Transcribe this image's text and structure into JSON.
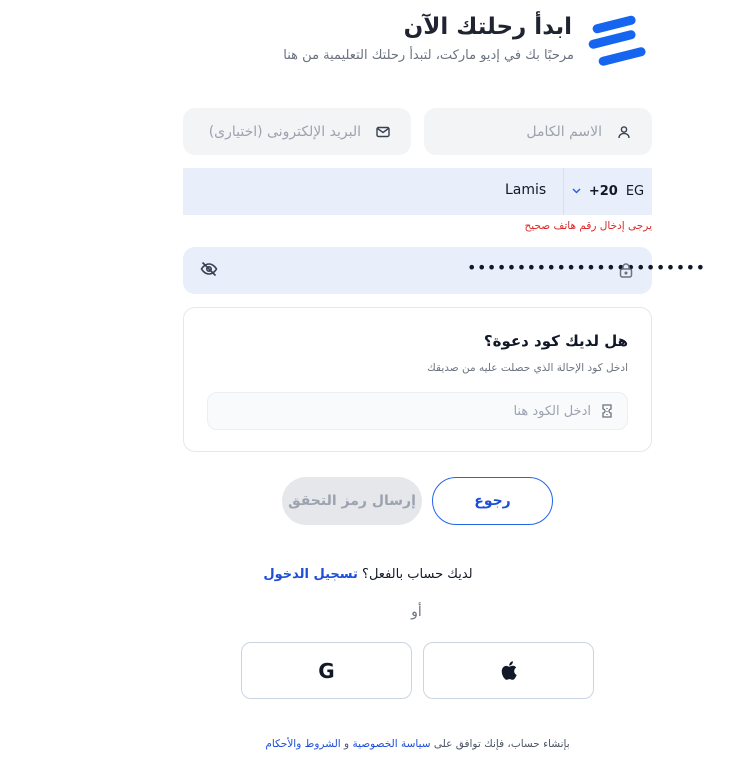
{
  "header": {
    "title": "ابدأ رحلتك الآن",
    "subtitle": "مرحبًا بك في إديو ماركت، لتبدأ رحلتك التعليمية من هنا",
    "logo_icon": "edumarket-logo-icon"
  },
  "form": {
    "full_name": {
      "placeholder": "الاسم الكامل",
      "icon": "user-icon"
    },
    "email": {
      "placeholder": "البريد الإلكترونى (اختيارى)",
      "icon": "mail-icon"
    },
    "phone": {
      "value": "Lamis",
      "country": "EG",
      "dial_code": "+20",
      "icon": "chevron-down-icon"
    },
    "phone_error": "يرجى إدخال رقم هاتف صحيح",
    "password": {
      "value": "••••••••••••••••••••••••",
      "icon": "lock-icon",
      "toggle_icon": "eye-off-icon"
    }
  },
  "invite": {
    "title": "هل لديك كود دعوة؟",
    "description": "ادخل كود الإحالة الذي حصلت عليه من صديقك",
    "placeholder": "ادخل الكود هنا",
    "icon": "ticket-icon"
  },
  "actions": {
    "back_label": "رجوع",
    "send_code_label": "إرسال رمز التحقق"
  },
  "login": {
    "prompt": "لديك حساب بالفعل؟",
    "link": "تسجيل الدخول"
  },
  "divider_text": "أو",
  "social": {
    "google_label": "G",
    "google_icon": "google-icon",
    "apple_icon": "apple-icon"
  },
  "terms": {
    "prefix": "بإنشاء حساب، فإنك توافق على",
    "privacy_link": "سياسة الخصوصية",
    "conjunction": "و",
    "terms_link": "الشروط والأحكام"
  },
  "colors": {
    "accent": "#2563eb",
    "error": "#dc2626",
    "field_bg": "#f3f4f6",
    "active_field_bg": "#e8effb"
  }
}
